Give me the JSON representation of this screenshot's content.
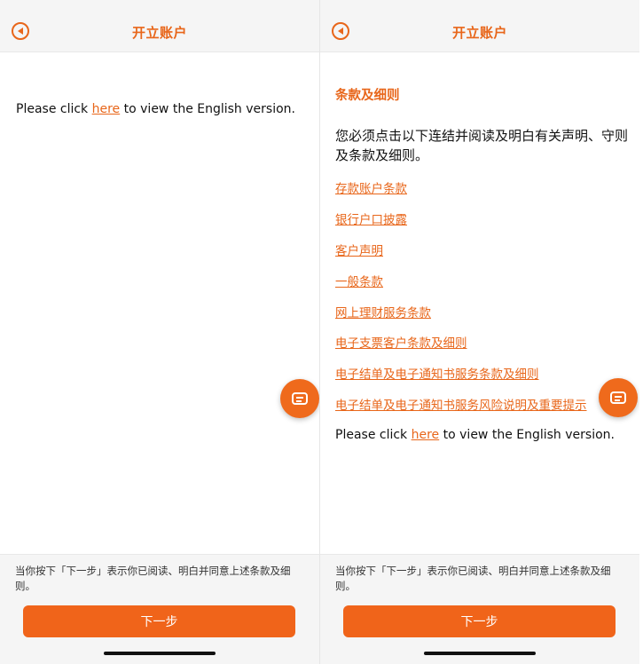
{
  "left_screen": {
    "header": {
      "title": "开立账户",
      "back_icon": "back-circle-icon"
    },
    "english_line": {
      "prefix": "Please click ",
      "link": "here",
      "suffix": " to view the English version."
    },
    "footer": {
      "consent": "当你按下「下一步」表示你已阅读、明白并同意上述条款及细则。",
      "next_label": "下一步"
    }
  },
  "right_screen": {
    "header": {
      "title": "开立账户",
      "back_icon": "back-circle-icon"
    },
    "section_title": "条款及细则",
    "intro": "您必须点击以下连结并阅读及明白有关声明、守则及条款及细则。",
    "links": [
      "存款账户条款",
      "银行户口披露",
      "客户声明",
      "一般条款",
      "网上理财服务条款",
      "电子支票客户条款及细则",
      "电子结单及电子通知书服务条款及细则",
      "电子结单及电子通知书服务风险说明及重要提示"
    ],
    "english_line": {
      "prefix": "Please click ",
      "link": "here",
      "suffix": " to view the English version."
    },
    "footer": {
      "consent": "当你按下「下一步」表示你已阅读、明白并同意上述条款及细则。",
      "next_label": "下一步"
    }
  },
  "colors": {
    "accent": "#e8661a",
    "button": "#f0641a",
    "header_bg": "#f5f5f5"
  },
  "chat_icon": "chat-bubble-icon"
}
